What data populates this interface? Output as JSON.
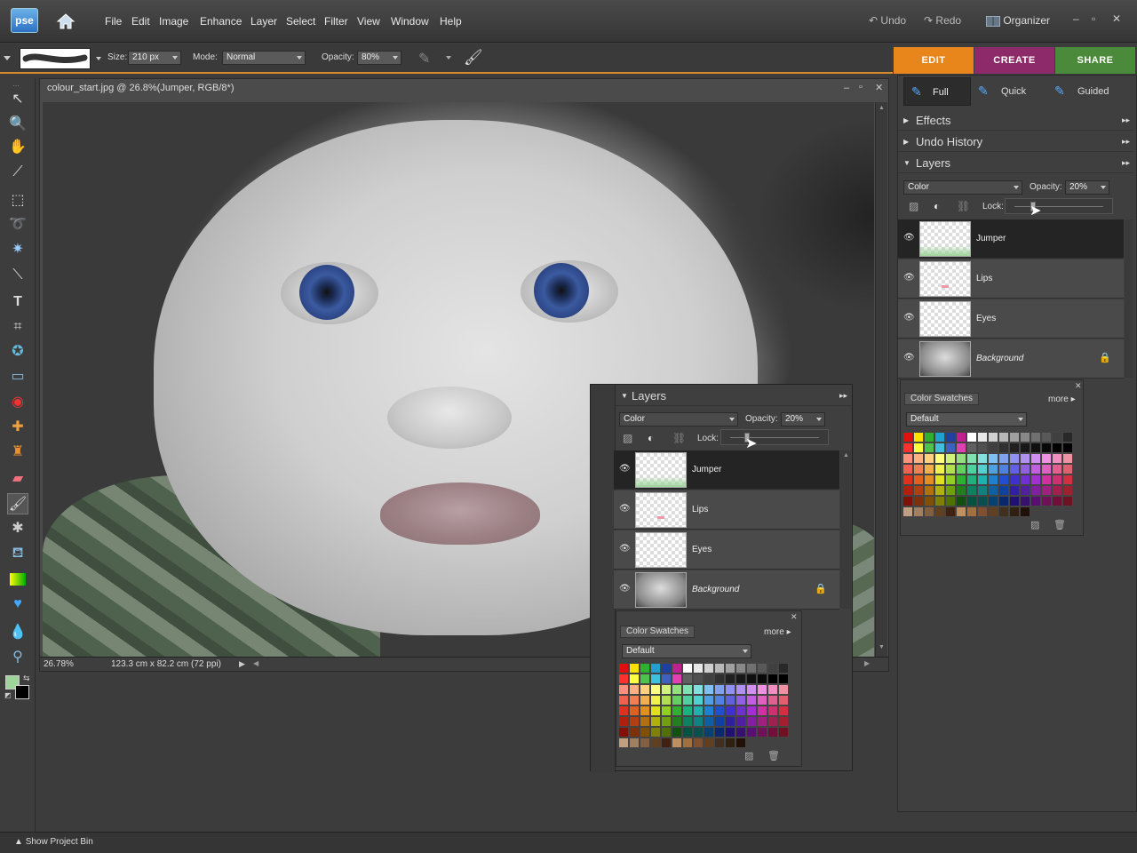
{
  "app": {
    "logo": "pse"
  },
  "menu": [
    "File",
    "Edit",
    "Image",
    "Enhance",
    "Layer",
    "Select",
    "Filter",
    "View",
    "Window",
    "Help"
  ],
  "top_actions": {
    "undo": "Undo",
    "redo": "Redo",
    "organizer": "Organizer"
  },
  "options": {
    "size_label": "Size:",
    "size_value": "210 px",
    "mode_label": "Mode:",
    "mode_value": "Normal",
    "opacity_label": "Opacity:",
    "opacity_value": "80%"
  },
  "mode_tabs": [
    {
      "label": "EDIT",
      "color": "#e8861c"
    },
    {
      "label": "CREATE",
      "color": "#8c2a6a"
    },
    {
      "label": "SHARE",
      "color": "#4a8a3a"
    }
  ],
  "edit_modes": [
    "Full",
    "Quick",
    "Guided"
  ],
  "document": {
    "title": "colour_start.jpg @ 26.8%(Jumper, RGB/8*)",
    "zoom": "26.78%",
    "dimensions": "123.3 cm x 82.2 cm (72 ppi)"
  },
  "panel_sections": [
    "Effects",
    "Undo History",
    "Layers"
  ],
  "layers_panel": {
    "title": "Layers",
    "blend_mode": "Color",
    "opacity_label": "Opacity:",
    "opacity_value": "20%",
    "lock_label": "Lock:",
    "layers": [
      {
        "name": "Jumper",
        "selected": true
      },
      {
        "name": "Lips",
        "selected": false
      },
      {
        "name": "Eyes",
        "selected": false
      },
      {
        "name": "Background",
        "selected": false,
        "locked": true
      }
    ]
  },
  "swatches": {
    "tab": "Color Swatches",
    "more": "more",
    "preset": "Default"
  },
  "bottom": {
    "project_bin": "Show Project Bin"
  }
}
